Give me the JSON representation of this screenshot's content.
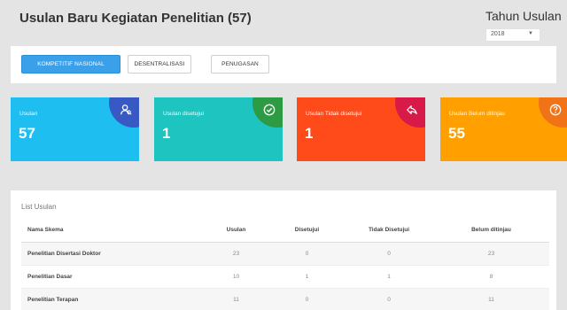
{
  "header": {
    "title": "Usulan Baru Kegiatan Penelitian (57)",
    "year_label": "Tahun Usulan",
    "year_value": "2018"
  },
  "tabs": [
    {
      "label": "KOMPETITIF NASIONAL",
      "active": true
    },
    {
      "label": "DESENTRALISASI",
      "active": false
    },
    {
      "label": "PENUGASAN",
      "active": false
    }
  ],
  "cards": [
    {
      "label": "Usulan",
      "value": "57",
      "icon": "user-search-icon",
      "color": "#1ebef1"
    },
    {
      "label": "Usulan disetujui",
      "value": "1",
      "icon": "check-circle-icon",
      "color": "#1dc4c0"
    },
    {
      "label": "Usulan Tidak disetujui",
      "value": "1",
      "icon": "reply-icon",
      "color": "#ff4a1a"
    },
    {
      "label": "Usulan Belum ditinjau",
      "value": "55",
      "icon": "question-circle-icon",
      "color": "#ffa000"
    }
  ],
  "list": {
    "title": "List Usulan",
    "columns": [
      "Nama Skema",
      "Usulan",
      "Disetujui",
      "Tidak Disetujui",
      "Belum ditinjau"
    ],
    "rows": [
      [
        "Penelitian Disertasi Doktor",
        "23",
        "0",
        "0",
        "23"
      ],
      [
        "Penelitian Dasar",
        "10",
        "1",
        "1",
        "8"
      ],
      [
        "Penelitian Terapan",
        "11",
        "0",
        "0",
        "11"
      ]
    ]
  }
}
